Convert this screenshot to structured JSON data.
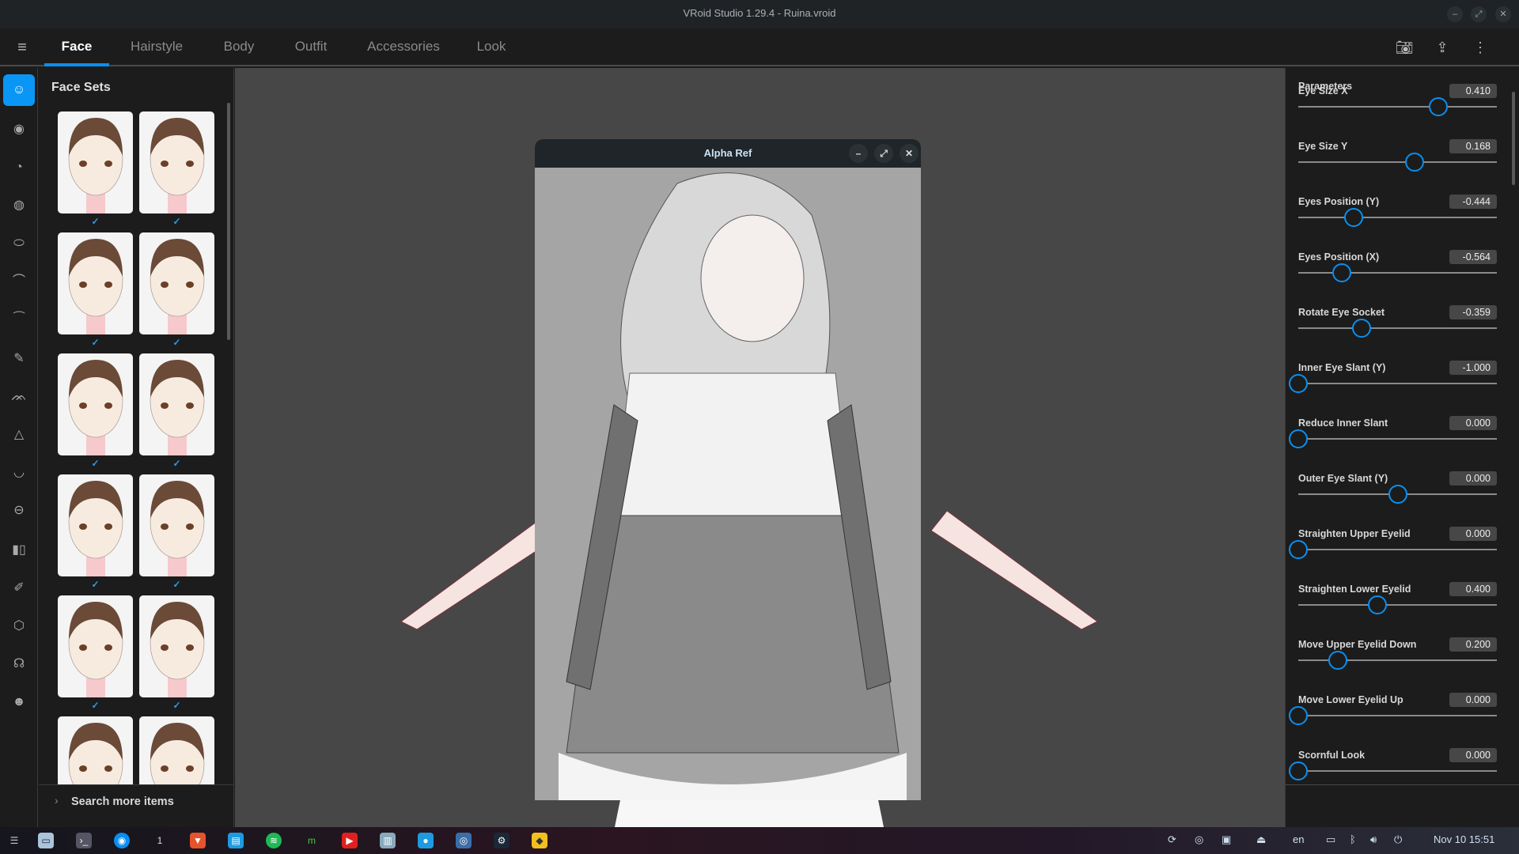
{
  "window": {
    "title": "VRoid Studio 1.29.4 - Ruina.vroid",
    "controls": [
      "minimize",
      "maximize",
      "close"
    ]
  },
  "tabs": [
    {
      "label": "Face",
      "active": true
    },
    {
      "label": "Hairstyle"
    },
    {
      "label": "Body"
    },
    {
      "label": "Outfit"
    },
    {
      "label": "Accessories"
    },
    {
      "label": "Look"
    }
  ],
  "toolbar_icons": [
    "camera-icon",
    "export-icon",
    "more-vert-icon"
  ],
  "accent": "#0a8ff0",
  "rail_icons": [
    "face-set-icon",
    "eye-icon",
    "iris-icon",
    "eye-highlight-icon",
    "eye-white-icon",
    "eyelash-icon",
    "eyebrow-icon",
    "eyeliner-icon",
    "eyelid-icon",
    "nose-icon",
    "mouth-icon",
    "lips-icon",
    "teeth-icon",
    "makeup-icon",
    "face-shape-icon",
    "head-icon",
    "expression-icon"
  ],
  "left_panel": {
    "title": "Face Sets",
    "tile_count": 12,
    "search_more": "Search more items"
  },
  "alpha_ref": {
    "title": "Alpha Ref"
  },
  "parameters": {
    "title": "Parameters",
    "items": [
      {
        "label": "Eye Size X",
        "value": "0.410",
        "num": 0.41,
        "min": -1,
        "max": 1
      },
      {
        "label": "Eye Size Y",
        "value": "0.168",
        "num": 0.168,
        "min": -1,
        "max": 1
      },
      {
        "label": "Eyes Position (Y)",
        "value": "-0.444",
        "num": -0.444,
        "min": -1,
        "max": 1
      },
      {
        "label": "Eyes Position (X)",
        "value": "-0.564",
        "num": -0.564,
        "min": -1,
        "max": 1
      },
      {
        "label": "Rotate Eye Socket",
        "value": "-0.359",
        "num": -0.359,
        "min": -1,
        "max": 1
      },
      {
        "label": "Inner Eye Slant (Y)",
        "value": "-1.000",
        "num": -1,
        "min": -1,
        "max": 1
      },
      {
        "label": "Reduce Inner Slant",
        "value": "0.000",
        "num": 0,
        "min": 0,
        "max": 1
      },
      {
        "label": "Outer Eye Slant (Y)",
        "value": "0.000",
        "num": 0,
        "min": -1,
        "max": 1
      },
      {
        "label": "Straighten Upper Eyelid",
        "value": "0.000",
        "num": 0,
        "min": 0,
        "max": 1
      },
      {
        "label": "Straighten Lower Eyelid",
        "value": "0.400",
        "num": 0.4,
        "min": 0,
        "max": 1
      },
      {
        "label": "Move Upper Eyelid Down",
        "value": "0.200",
        "num": 0.2,
        "min": 0,
        "max": 1
      },
      {
        "label": "Move Lower Eyelid Up",
        "value": "0.000",
        "num": 0,
        "min": 0,
        "max": 1
      },
      {
        "label": "Scornful Look",
        "value": "0.000",
        "num": 0,
        "min": 0,
        "max": 1
      }
    ]
  },
  "taskbar": {
    "workspace": "1",
    "language": "en",
    "clock": "Nov 10  15:51"
  }
}
